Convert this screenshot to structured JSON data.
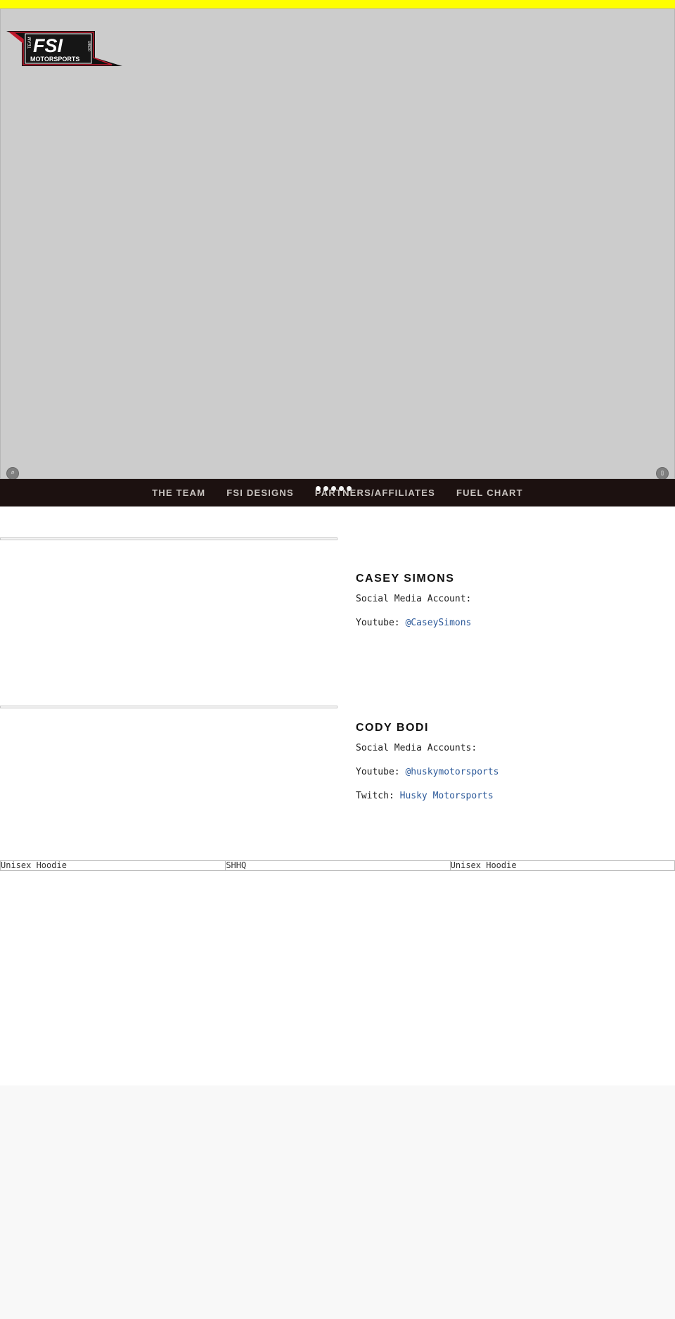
{
  "logo": {
    "title": "FSI",
    "subtitle": "MOTORSPORTS",
    "left_text": "TEAM",
    "right_text": "U8520",
    "accent": "#c0192c"
  },
  "hero": {
    "background": "#cccccc",
    "left_control_icon": "search-icon",
    "left_control_glyph": "⌕",
    "right_control_icon": "pause-icon",
    "right_control_glyph": "▯",
    "slide_count": 5,
    "active_slide": 1
  },
  "nav": {
    "items": [
      {
        "label": "THE TEAM"
      },
      {
        "label": "FSI DESIGNS"
      },
      {
        "label": "PARTNERS/AFFILIATES"
      },
      {
        "label": "FUEL CHART"
      }
    ]
  },
  "members": [
    {
      "name": "CASEY SIMONS",
      "heading": "Social Media Account:",
      "links": [
        {
          "platform": "Youtube:",
          "handle": "@CaseySimons"
        }
      ]
    },
    {
      "name": "CODY BODI",
      "heading": "Social Media Accounts:",
      "links": [
        {
          "platform": "Youtube:",
          "handle": "@huskymotorsports"
        },
        {
          "platform": "Twitch:",
          "handle": "Husky Motorsports"
        }
      ]
    }
  ],
  "products": [
    {
      "label": "Unisex Hoodie"
    },
    {
      "label": "SHHQ"
    },
    {
      "label": "Unisex Hoodie"
    }
  ],
  "colors": {
    "top_strip": "#ffff00",
    "nav_background": "#1c1110",
    "link": "#2d5a9a"
  }
}
